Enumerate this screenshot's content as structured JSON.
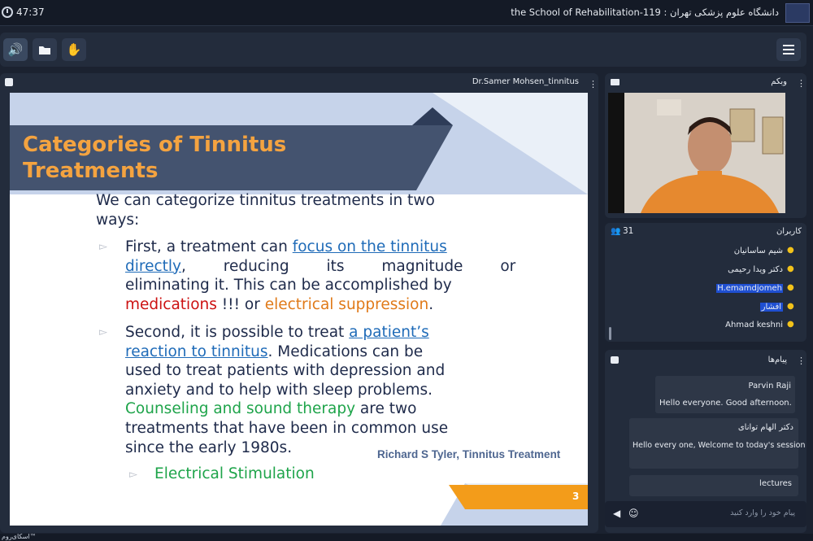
{
  "topbar": {
    "timer": "47:37",
    "room_title": "the School of Rehabilitation-119 : دانشگاه علوم پزشکی تهران"
  },
  "toolbar": {
    "speaker_icon": "speaker-icon",
    "folder_icon": "folder-icon",
    "hand_icon": "raise-hand-icon",
    "menu_icon": "hamburger-menu-icon"
  },
  "presentation": {
    "title": "Dr.Samer Mohsen_tinnitus",
    "slide": {
      "heading_line1": "Categories of Tinnitus",
      "heading_line2": "Treatments",
      "intro_line1": "We can categorize tinnitus treatments in two",
      "intro_line2": "ways:",
      "b1_l1_a": "First, a treatment can ",
      "b1_l1_link": "focus on the tinnitus",
      "b1_l2_link": "directly",
      "b1_l2_b": ", reducing its magnitude or",
      "b1_l3": "eliminating it. This can be accomplished by",
      "b1_l4_red": "medications",
      "b1_l4_mid": " !!! or ",
      "b1_l4_orange": "electrical suppression",
      "b1_l4_end": ".",
      "b2_l1_a": "Second, it is possible to treat ",
      "b2_l1_link": "a patient’s",
      "b2_l2_link": "reaction to tinnitus",
      "b2_l2_b": ". Medications can be",
      "b2_l3": "used to treat patients with depression and",
      "b2_l4": "anxiety and to help with sleep problems.",
      "b2_l5_green": "Counseling and sound therapy",
      "b2_l5_b": " are two",
      "b2_l6": "treatments that have been in common use",
      "b2_l7": "since the early 1980s.",
      "sub_bullet": "Electrical Stimulation",
      "citation": "Richard S Tyler, Tinnitus Treatment",
      "page": "3"
    }
  },
  "webcam": {
    "title": "وبکم"
  },
  "users": {
    "title": "کاربران",
    "count": "31",
    "list": [
      {
        "name": "شیم ساسانیان",
        "highlighted": false
      },
      {
        "name": "دکتر ویدا رحیمی",
        "highlighted": false
      },
      {
        "name": "H.emamdjomeh",
        "highlighted": true
      },
      {
        "name": "افشار",
        "highlighted": true
      },
      {
        "name": "Ahmad keshni",
        "highlighted": false
      }
    ]
  },
  "messages": {
    "title": "پیام‌ها",
    "items": [
      {
        "sender": "Parvin Raji",
        "text": "Hello everyone. Good afternoon."
      },
      {
        "sender": "دکتر الهام توانای",
        "text": "Hello every one, Welcome to today's session"
      },
      {
        "sender": "",
        "text": "lectures"
      }
    ],
    "input_placeholder": "پیام خود را وارد کنید"
  },
  "footer": {
    "brand": "اسکای‌روم™"
  },
  "colors": {
    "accent": "#5cc8ff",
    "slide_title": "#f4a340",
    "slide_banner": "#44536f",
    "highlight": "#1f4fd1"
  }
}
